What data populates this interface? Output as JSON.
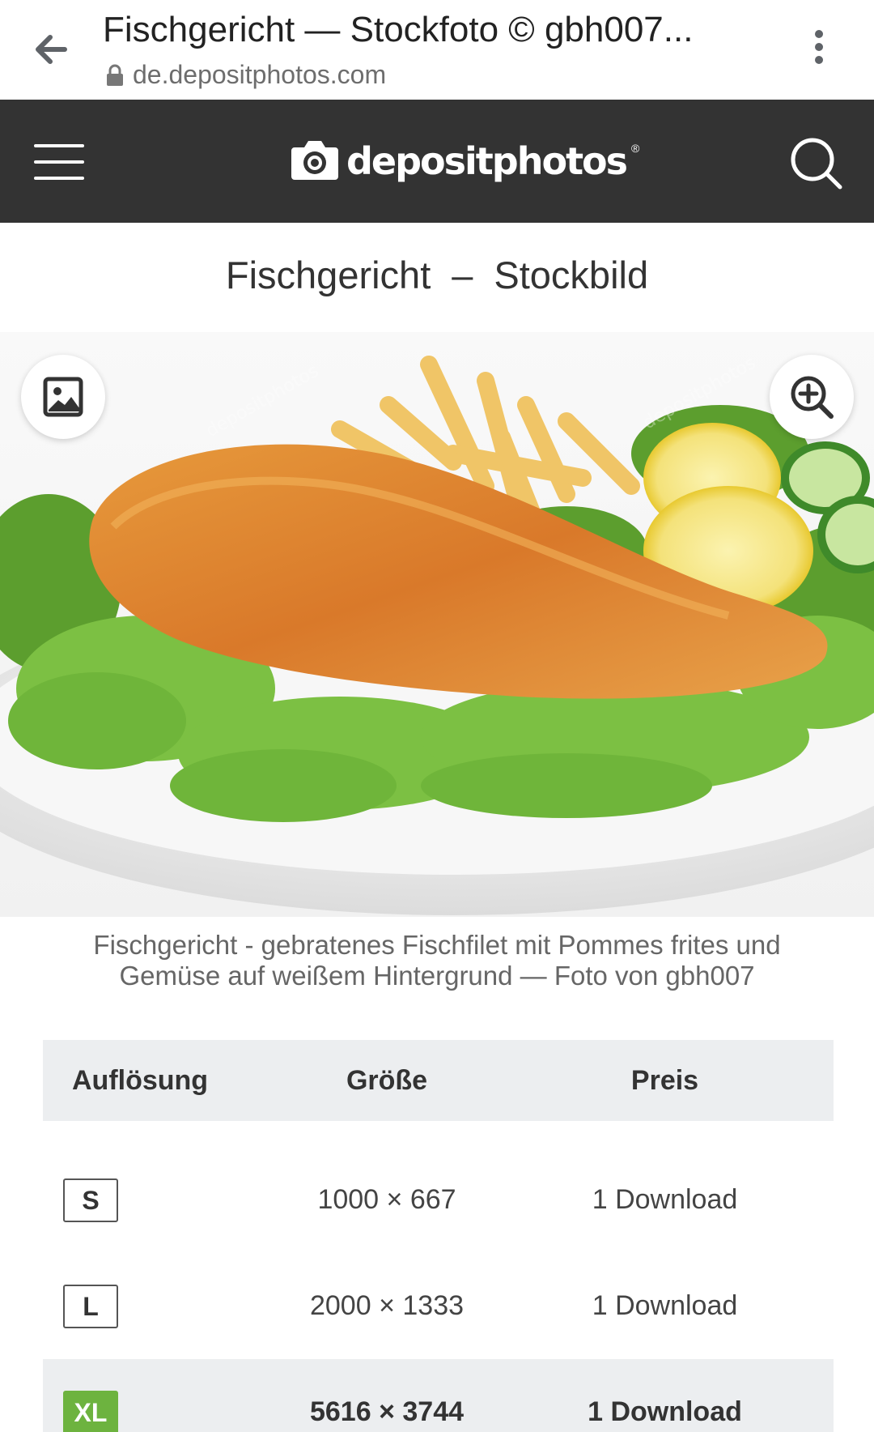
{
  "browser": {
    "tab_title": "Fischgericht — Stockfoto © gbh007...",
    "url": "de.depositphotos.com"
  },
  "header": {
    "logo_text": "depositphotos",
    "logo_reg": "®",
    "background_color": "#333333"
  },
  "page": {
    "title_main": "Fischgericht",
    "title_sep": "–",
    "title_type": "Stockbild"
  },
  "image": {
    "caption": "Fischgericht - gebratenes Fischfilet mit Pommes frites und Gemüse auf weißem Hintergrund — Foto von gbh007",
    "left_button_icon": "image-icon",
    "right_button_icon": "zoom-in-icon"
  },
  "table": {
    "headers": {
      "resolution": "Auflösung",
      "size": "Größe",
      "price": "Preis"
    },
    "rows": [
      {
        "badge": "S",
        "size": "1000 × 667",
        "price": "1 Download",
        "selected": false
      },
      {
        "badge": "L",
        "size": "2000 × 1333",
        "price": "1 Download",
        "selected": false
      },
      {
        "badge": "XL",
        "size": "5616 × 3744",
        "price": "1 Download",
        "selected": true
      }
    ],
    "accent_color": "#6db33f"
  }
}
